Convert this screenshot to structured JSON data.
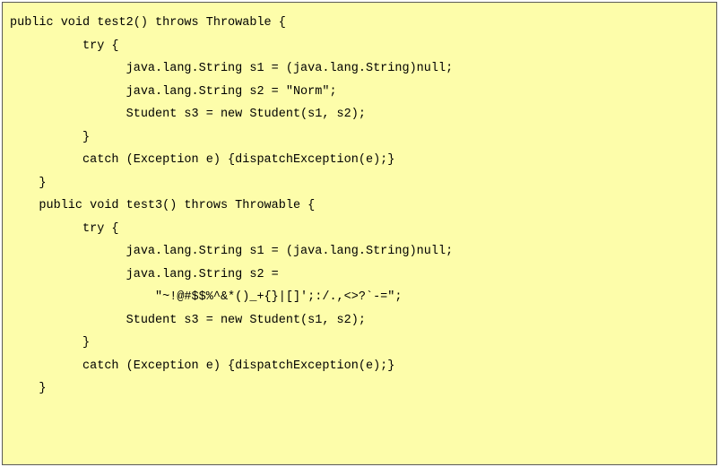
{
  "code": {
    "lines": [
      "public void test2() throws Throwable {",
      "          try {",
      "                java.lang.String s1 = (java.lang.String)null;",
      "                java.lang.String s2 = \"Norm\";",
      "                Student s3 = new Student(s1, s2);",
      "          }",
      "          catch (Exception e) {dispatchException(e);}",
      "    }",
      "",
      "    public void test3() throws Throwable {",
      "          try {",
      "                java.lang.String s1 = (java.lang.String)null;",
      "                java.lang.String s2 =",
      "                    \"~!@#$$%^&*()_+{}|[]';:/.,<>?`-=\";",
      "                Student s3 = new Student(s1, s2);",
      "          }",
      "          catch (Exception e) {dispatchException(e);}",
      "    }"
    ]
  }
}
